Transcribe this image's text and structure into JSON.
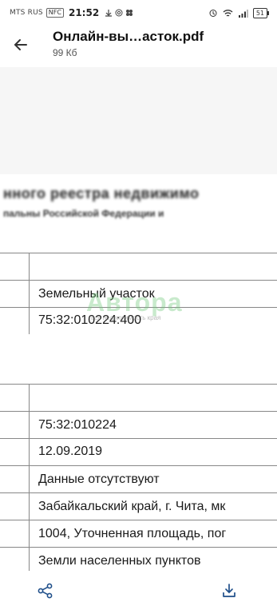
{
  "status_bar": {
    "carrier": "MTS RUS",
    "nfc": "NFC",
    "time": "21:52",
    "notif_icons": [
      "download-icon",
      "at-icon",
      "app-icon"
    ],
    "battery": "51",
    "right_icons": [
      "alarm-icon",
      "wifi-icon",
      "signal-icon"
    ]
  },
  "header": {
    "title": "Онлайн-вы…асток.pdf",
    "subtitle": "99 Кб",
    "back_icon": "back-arrow-icon"
  },
  "document": {
    "blurred_line_1": "нного реестра недвижимо",
    "blurred_line_2": "пальны Российской Федерации и",
    "rows": [
      "Земельный участок",
      "75:32:010224:400",
      "",
      "75:32:010224",
      "12.09.2019",
      "Данные отсутствуют",
      "Забайкальский край, г. Чита, мк",
      "1004, Уточненная площадь, пог",
      "Земли населенных пунктов"
    ],
    "watermark": {
      "brand": "Автора",
      "tagline": "вся недвижимость края"
    }
  },
  "bottom_bar": {
    "share_icon": "share-icon",
    "download_icon": "download-icon"
  },
  "colors": {
    "accent": "#1f4f8a",
    "watermark_green": "#6ec878"
  }
}
